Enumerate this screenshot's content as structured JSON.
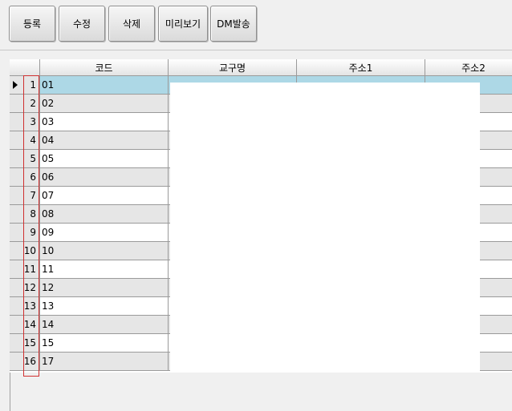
{
  "toolbar": {
    "buttons": [
      {
        "label": "등록"
      },
      {
        "label": "수정"
      },
      {
        "label": "삭제"
      },
      {
        "label": "미리보기"
      },
      {
        "label": "DM발송"
      }
    ]
  },
  "grid": {
    "columns": [
      "코드",
      "교구명",
      "주소1",
      "주소2"
    ],
    "rows": [
      {
        "num": "1",
        "code": "01",
        "selected": true
      },
      {
        "num": "2",
        "code": "02"
      },
      {
        "num": "3",
        "code": "03"
      },
      {
        "num": "4",
        "code": "04"
      },
      {
        "num": "5",
        "code": "05"
      },
      {
        "num": "6",
        "code": "06"
      },
      {
        "num": "7",
        "code": "07"
      },
      {
        "num": "8",
        "code": "08"
      },
      {
        "num": "9",
        "code": "09"
      },
      {
        "num": "10",
        "code": "10"
      },
      {
        "num": "11",
        "code": "11"
      },
      {
        "num": "12",
        "code": "12"
      },
      {
        "num": "13",
        "code": "13"
      },
      {
        "num": "14",
        "code": "14"
      },
      {
        "num": "15",
        "code": "15"
      },
      {
        "num": "16",
        "code": "17"
      }
    ]
  },
  "colors": {
    "selected_row": "#add8e6",
    "alt_row": "#e6e6e6",
    "highlight_box": "#d03030"
  }
}
